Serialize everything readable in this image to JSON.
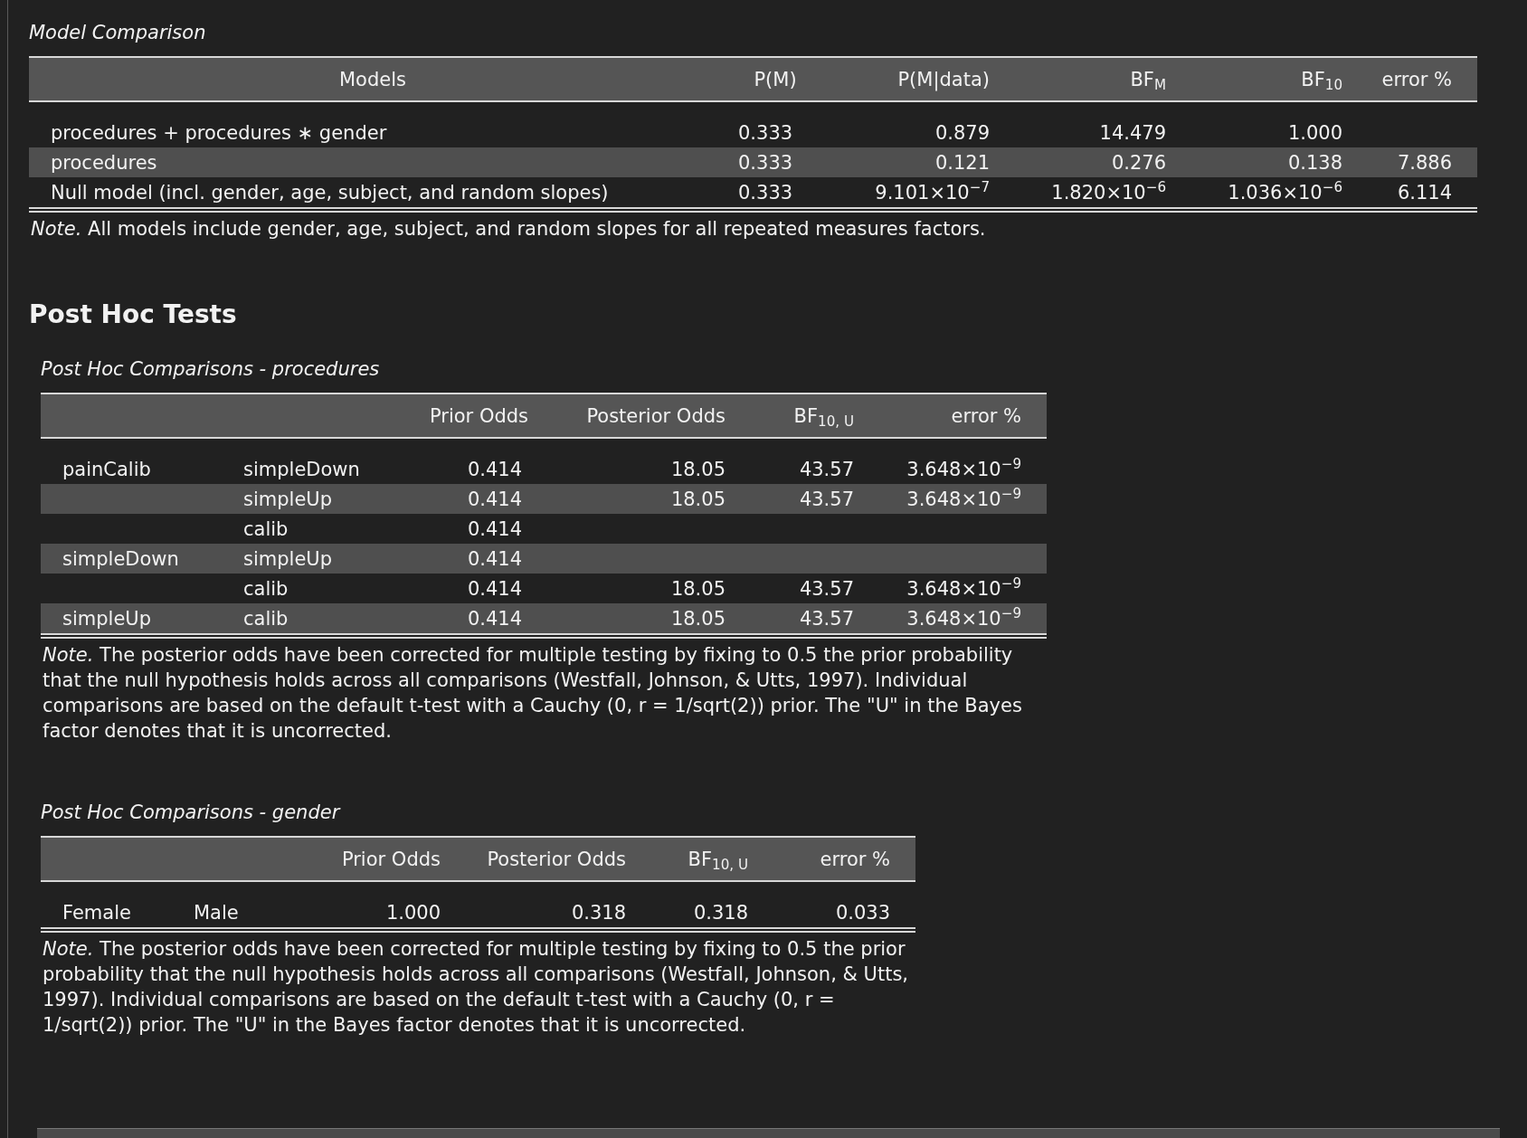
{
  "model_comparison": {
    "title": "Model Comparison",
    "columns": [
      "Models",
      "P(M)",
      "P(M|data)",
      "BF$_{M}$",
      "BF$_{10}$",
      "error %"
    ],
    "rows": [
      {
        "cells": [
          "procedures + procedures ∗ gender",
          "0.333",
          "0.879",
          "14.479",
          "1.000",
          null
        ]
      },
      {
        "cells": [
          "procedures",
          "0.333",
          "0.121",
          "0.276",
          "0.138",
          "7.886"
        ]
      },
      {
        "cells": [
          "Null model (incl. gender, age, subject, and random slopes)",
          "0.333",
          "9.101×10$^{−7}$",
          "1.820×10$^{−6}$",
          "1.036×10$^{−6}$",
          "6.114"
        ]
      }
    ],
    "note": "*Note.* All models include gender, age, subject, and random slopes for all repeated measures factors."
  },
  "post_hoc": {
    "heading": "Post Hoc Tests",
    "tables": [
      {
        "title": "Post Hoc Comparisons - procedures",
        "columns": [
          null,
          null,
          "Prior Odds",
          "Posterior Odds",
          "BF$_{10, U}$",
          "error %"
        ],
        "rows": [
          {
            "cells": [
              "painCalib",
              "simpleDown",
              "0.414",
              "18.05",
              "43.57",
              "3.648×10$^{−9}$"
            ]
          },
          {
            "cells": [
              null,
              "simpleUp",
              "0.414",
              "18.05",
              "43.57",
              "3.648×10$^{−9}$"
            ]
          },
          {
            "cells": [
              null,
              "calib",
              "0.414",
              null,
              null,
              null
            ]
          },
          {
            "cells": [
              "simpleDown",
              "simpleUp",
              "0.414",
              null,
              null,
              null
            ]
          },
          {
            "cells": [
              null,
              "calib",
              "0.414",
              "18.05",
              "43.57",
              "3.648×10$^{−9}$"
            ]
          },
          {
            "cells": [
              "simpleUp",
              "calib",
              "0.414",
              "18.05",
              "43.57",
              "3.648×10$^{−9}$"
            ]
          }
        ],
        "note": "*Note.* The posterior odds have been corrected for multiple testing by fixing to 0.5 the prior probability that the null hypothesis holds across all comparisons (Westfall, Johnson, & Utts, 1997). Individual comparisons are based on the default t-test with a Cauchy (0, r = 1/sqrt(2)) prior. The \"U\" in the Bayes factor denotes that it is uncorrected."
      },
      {
        "title": "Post Hoc Comparisons - gender",
        "columns": [
          null,
          null,
          "Prior Odds",
          "Posterior Odds",
          "BF$_{10, U}$",
          "error %"
        ],
        "rows": [
          {
            "cells": [
              "Female",
              "Male",
              "1.000",
              "0.318",
              "0.318",
              "0.033"
            ]
          }
        ],
        "note": "*Note.* The posterior odds have been corrected for multiple testing by fixing to 0.5 the prior probability that the null hypothesis holds across all comparisons (Westfall, Johnson, & Utts, 1997). Individual comparisons are based on the default t-test with a Cauchy (0, r = 1/sqrt(2)) prior. The \"U\" in the Bayes factor denotes that it is uncorrected."
      }
    ]
  }
}
